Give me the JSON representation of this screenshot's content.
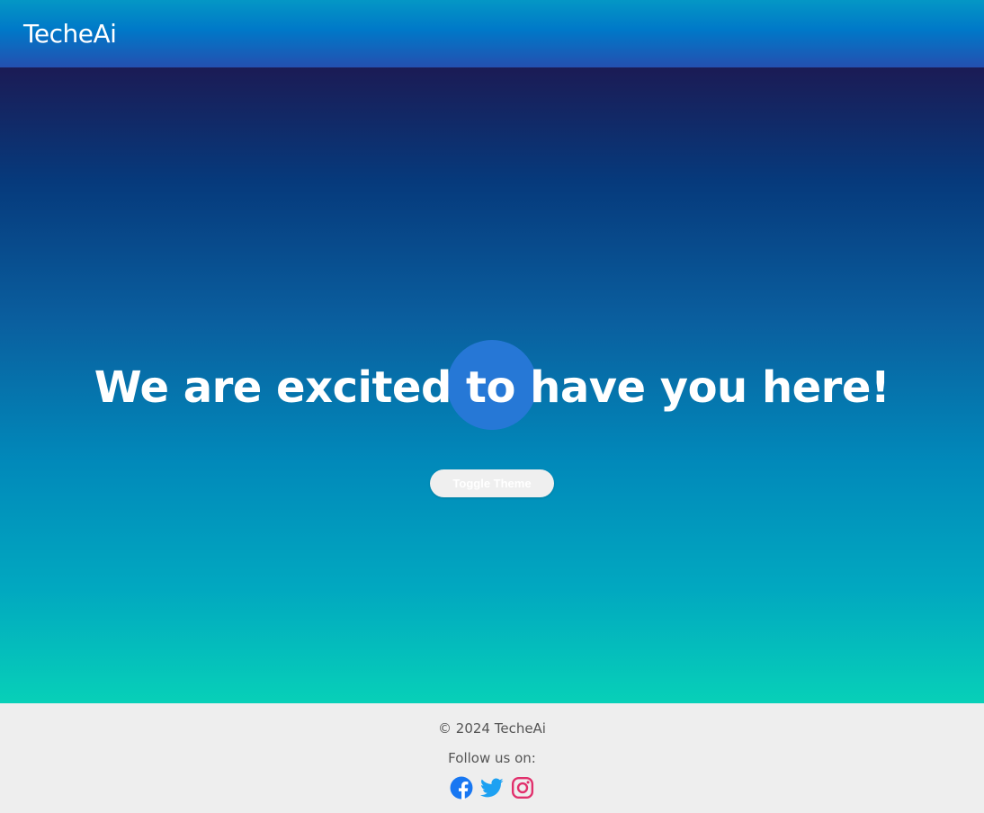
{
  "header": {
    "brand": "TecheAi"
  },
  "hero": {
    "headline": "We are excited to have you here!",
    "toggle_label": "Toggle Theme"
  },
  "footer": {
    "copyright": "© 2024 TecheAi",
    "follow_text": "Follow us on:",
    "socials": [
      {
        "icon": "facebook-icon",
        "color": "#1877f2"
      },
      {
        "icon": "twitter-icon",
        "color": "#1da1f2"
      },
      {
        "icon": "instagram-icon",
        "color": "#e1306c"
      }
    ]
  },
  "colors": {
    "header_top": "#0497c5",
    "header_bottom": "#2450b0",
    "hero_top": "#1b1b55",
    "hero_bottom": "#07d0b8",
    "blob": "#2878d8",
    "footer_bg": "#eeeeee"
  }
}
